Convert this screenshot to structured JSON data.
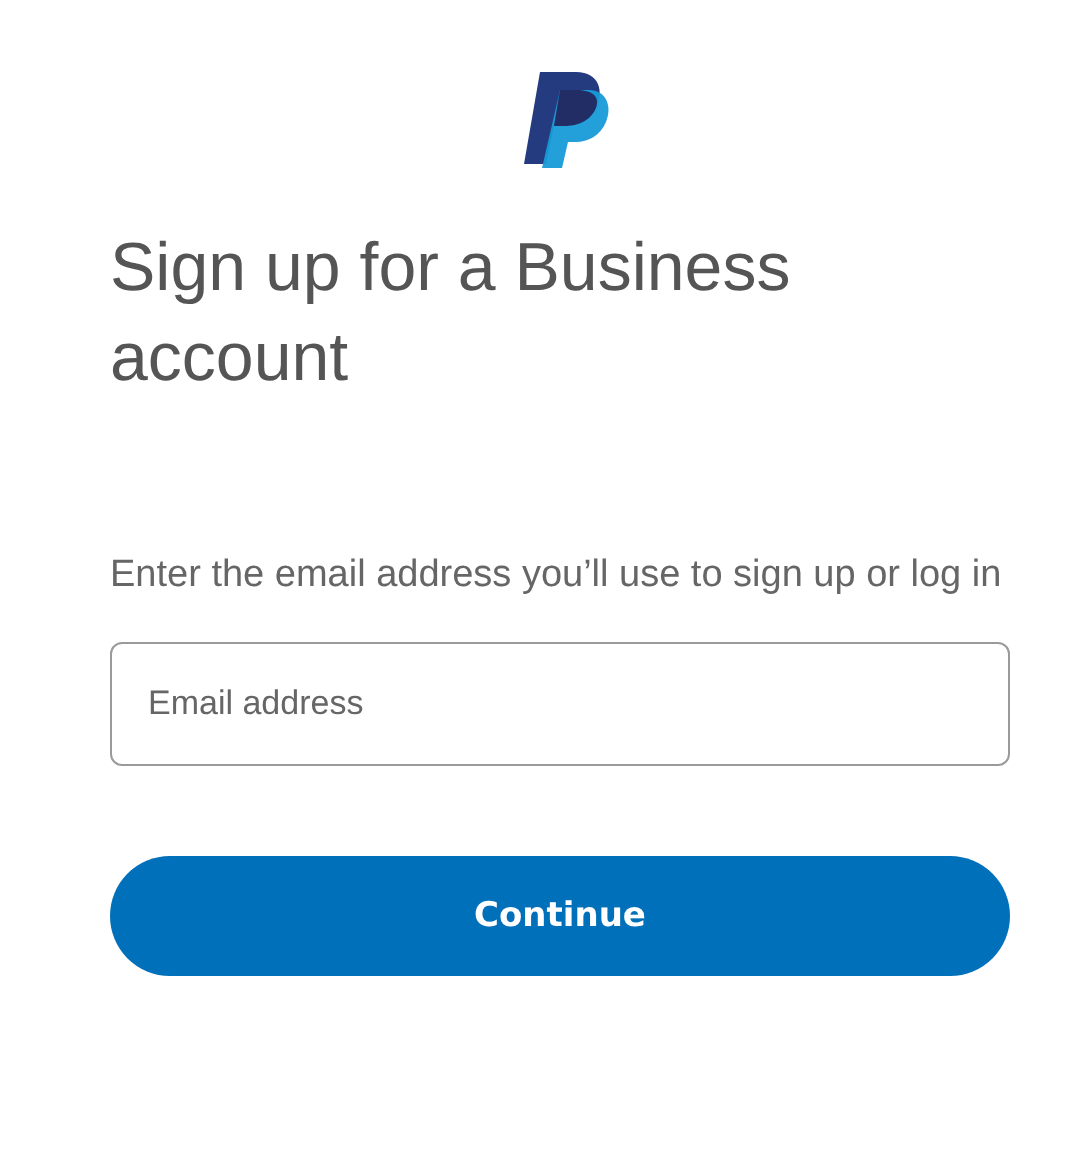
{
  "title": "Sign up for a Business account",
  "prompt": "Enter the email address you’ll use to sign up or log in",
  "email_field": {
    "placeholder": "Email address"
  },
  "button": {
    "label": "Continue"
  }
}
